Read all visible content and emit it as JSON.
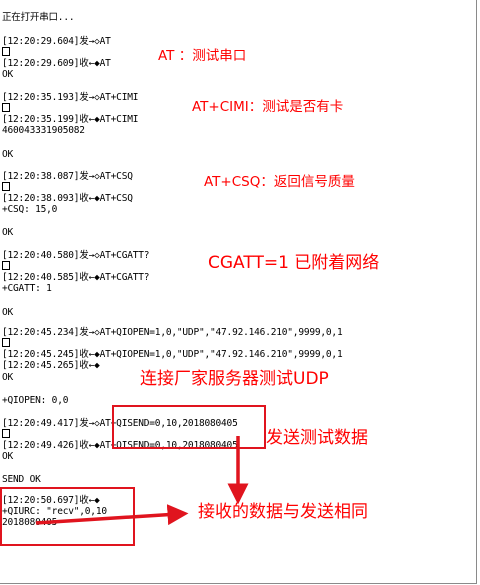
{
  "log": {
    "status": "正在打开串口...",
    "lines": [
      "[12:20:29.604]发→◇AT",
      "[12:20:29.609]收←◆AT",
      "OK",
      "[12:20:35.193]发→◇AT+CIMI",
      "[12:20:35.199]收←◆AT+CIMI",
      "460043331905082",
      "OK",
      "[12:20:38.087]发→◇AT+CSQ",
      "[12:20:38.093]收←◆AT+CSQ",
      "+CSQ: 15,0",
      "OK",
      "[12:20:40.580]发→◇AT+CGATT?",
      "[12:20:40.585]收←◆AT+CGATT?",
      "+CGATT: 1",
      "OK",
      "[12:20:45.234]发→◇AT+QIOPEN=1,0,\"UDP\",\"47.92.146.210\",9999,0,1",
      "[12:20:45.245]收←◆AT+QIOPEN=1,0,\"UDP\",\"47.92.146.210\",9999,0,1",
      "[12:20:45.265]收←◆",
      "OK",
      "+QIOPEN: 0,0",
      "[12:20:49.417]发→◇AT+QISEND=0,10,2018080405",
      "[12:20:49.426]收←◆AT+QISEND=0,10,2018080405",
      "OK",
      "SEND OK",
      "[12:20:50.697]收←◆",
      "+QIURC: \"recv\",0,10",
      "2018080405"
    ]
  },
  "annotations": {
    "at": "AT ：测试串口",
    "cimi": "AT+CIMI：测试是否有卡",
    "csq": "AT+CSQ：返回信号质量",
    "cgatt": "CGATT=1 已附着网络",
    "udp": "连接厂家服务器测试UDP",
    "send": "发送测试数据",
    "recv": "接收的数据与发送相同"
  },
  "colors": {
    "annotation": "#ff0000",
    "highlight": "#e0141e",
    "text": "#000000",
    "background": "#ffffff"
  }
}
